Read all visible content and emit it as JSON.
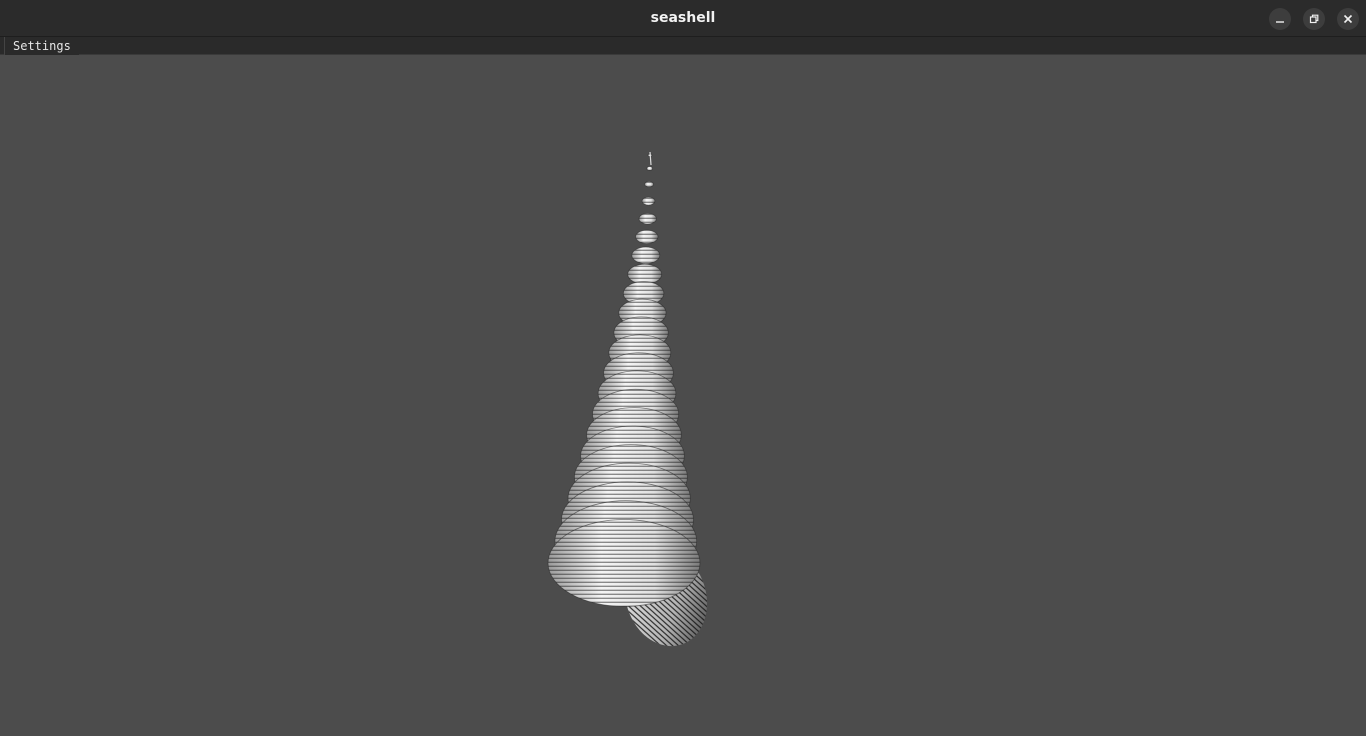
{
  "window": {
    "title": "seashell"
  },
  "menubar": {
    "items": [
      {
        "label": "Settings"
      }
    ]
  },
  "controls": {
    "minimize_icon": "minimize-icon",
    "maximize_icon": "restore-icon",
    "close_icon": "close-icon"
  },
  "scene": {
    "background_color": "#4c4c4c",
    "object": "seashell-model"
  }
}
